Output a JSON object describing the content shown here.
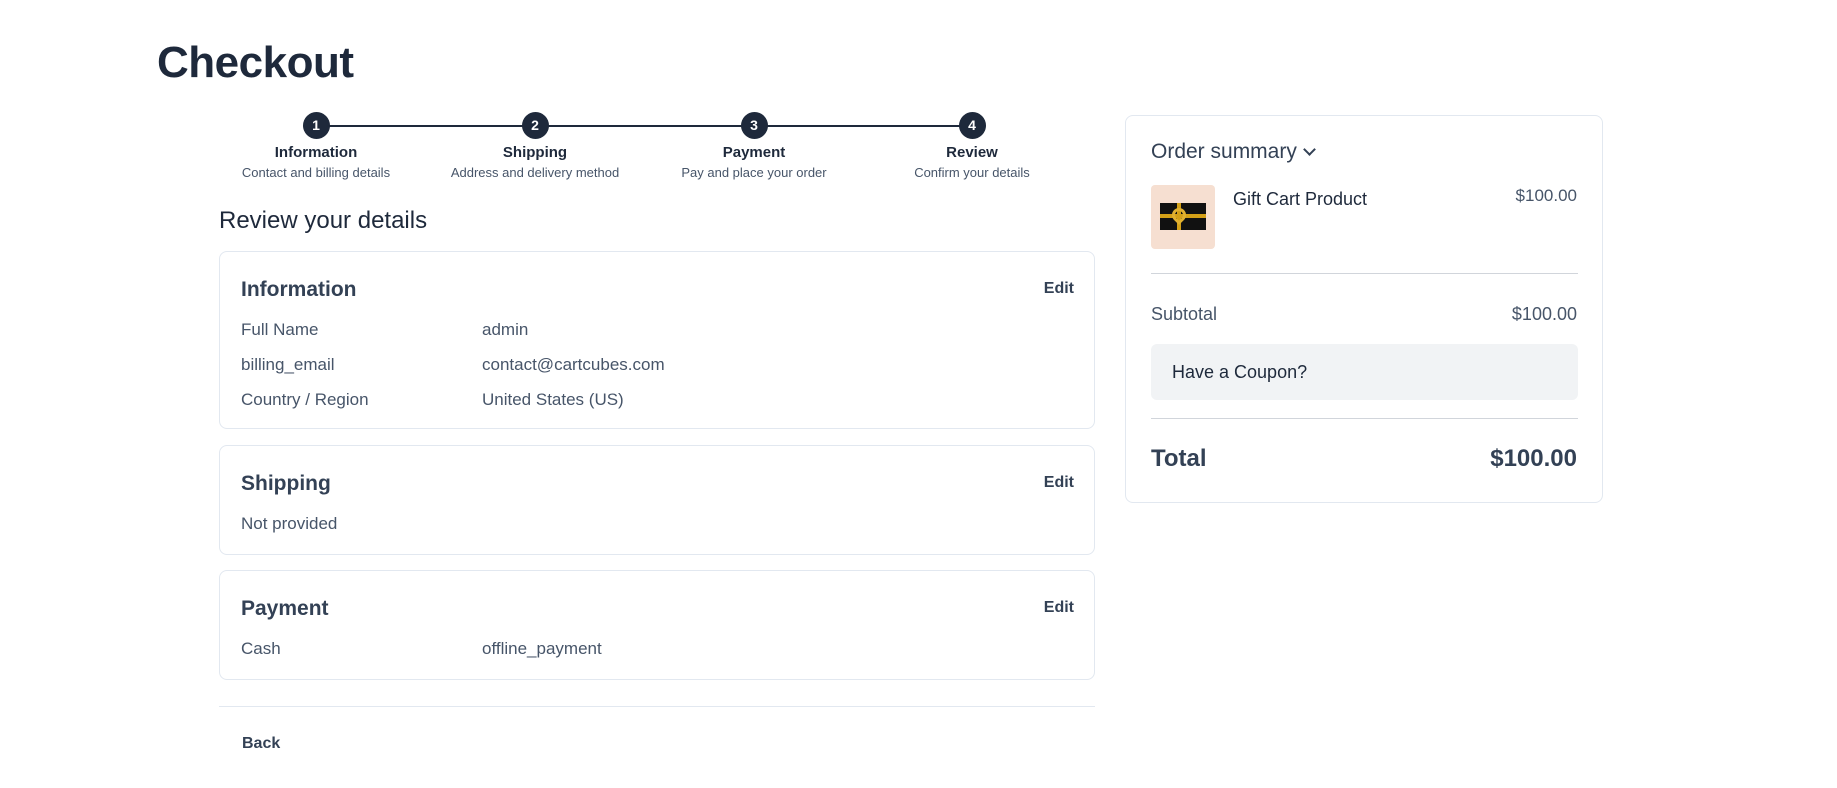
{
  "page": {
    "title": "Checkout"
  },
  "stepper": {
    "steps": [
      {
        "number": "1",
        "title": "Information",
        "subtitle": "Contact and billing details"
      },
      {
        "number": "2",
        "title": "Shipping",
        "subtitle": "Address and delivery method"
      },
      {
        "number": "3",
        "title": "Payment",
        "subtitle": "Pay and place your order"
      },
      {
        "number": "4",
        "title": "Review",
        "subtitle": "Confirm your details"
      }
    ]
  },
  "review": {
    "heading": "Review your details",
    "information": {
      "title": "Information",
      "edit_label": "Edit",
      "rows": [
        {
          "label": "Full Name",
          "value": "admin"
        },
        {
          "label": "billing_email",
          "value": "contact@cartcubes.com"
        },
        {
          "label": "Country / Region",
          "value": "United States (US)"
        }
      ]
    },
    "shipping": {
      "title": "Shipping",
      "edit_label": "Edit",
      "status": "Not provided"
    },
    "payment": {
      "title": "Payment",
      "edit_label": "Edit",
      "rows": [
        {
          "label": "Cash",
          "value": "offline_payment"
        }
      ]
    },
    "back_label": "Back"
  },
  "summary": {
    "heading": "Order summary",
    "product": {
      "name": "Gift Cart Product",
      "price": "$100.00",
      "icon": "gift-card-image"
    },
    "subtotal_label": "Subtotal",
    "subtotal_value": "$100.00",
    "coupon_label": "Have a Coupon?",
    "total_label": "Total",
    "total_value": "$100.00"
  },
  "colors": {
    "accent": "#1e293b",
    "border": "#e2e8f0",
    "thumb_bg": "#f6dfd1"
  }
}
